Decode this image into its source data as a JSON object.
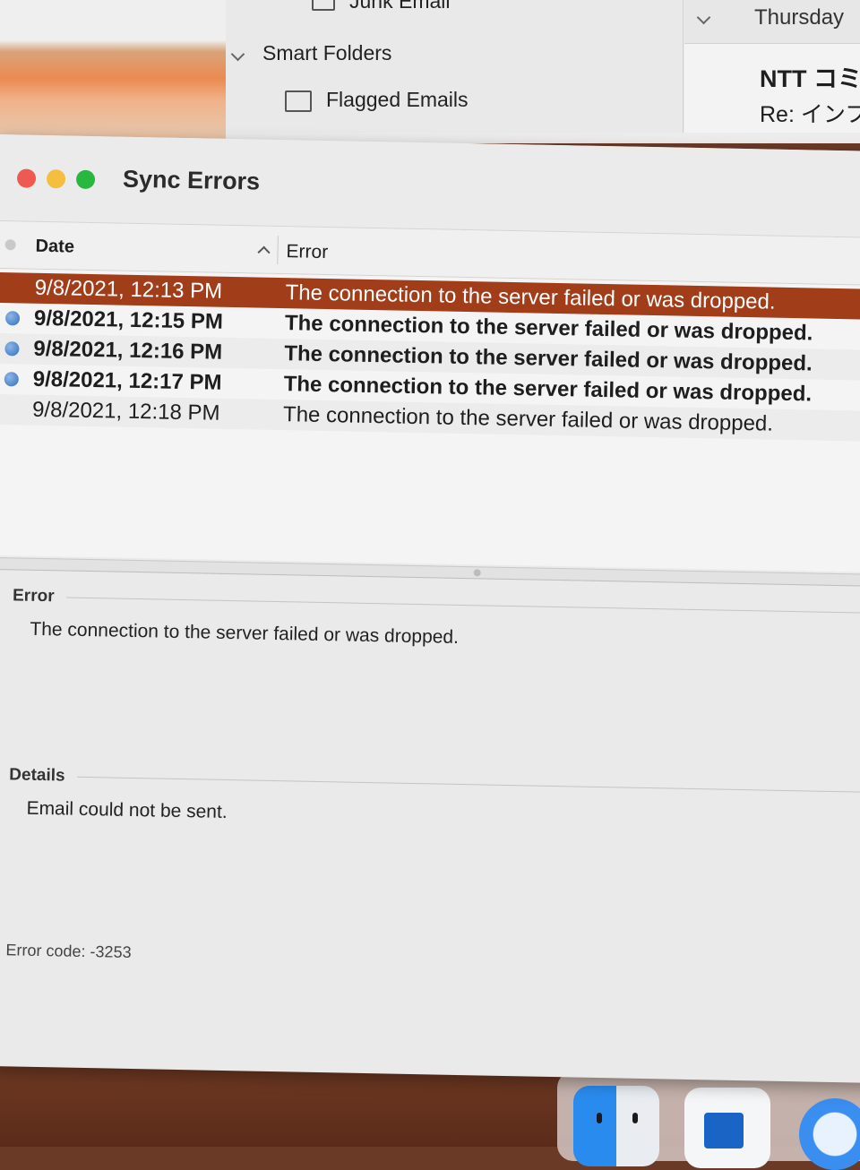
{
  "background_app": {
    "folders": {
      "junk_label": "Junk Email",
      "smart_folders_label": "Smart Folders",
      "flagged_label": "Flagged Emails"
    },
    "message_list": {
      "day_header": "Thursday",
      "sender": "NTT コミ",
      "subject": "Re: インフ"
    }
  },
  "window": {
    "title": "Sync Errors",
    "traffic_lights": {
      "close": "#ee5a52",
      "minimize": "#f4be3e",
      "zoom": "#27b840"
    }
  },
  "table": {
    "columns": {
      "date": "Date",
      "error": "Error"
    },
    "rows": [
      {
        "date": "9/8/2021, 12:13 PM",
        "error": "The connection to the server failed or was dropped.",
        "state": "selected"
      },
      {
        "date": "9/8/2021, 12:15 PM",
        "error": "The connection to the server failed or was dropped.",
        "state": "unread"
      },
      {
        "date": "9/8/2021, 12:16 PM",
        "error": "The connection to the server failed or was dropped.",
        "state": "unread"
      },
      {
        "date": "9/8/2021, 12:17 PM",
        "error": "The connection to the server failed or was dropped.",
        "state": "unread"
      },
      {
        "date": "9/8/2021, 12:18 PM",
        "error": "The connection to the server failed or was dropped.",
        "state": "read"
      }
    ]
  },
  "detail": {
    "error_label": "Error",
    "error_text": "The connection to the server failed or was dropped.",
    "details_label": "Details",
    "details_text": "Email could not be sent.",
    "error_code": "Error code: -3253"
  },
  "colors": {
    "selection": "#a23d1a",
    "unread_dot": "#2f6fc0"
  },
  "dock": {
    "apps": [
      "finder-icon",
      "outlook-icon",
      "safari-icon"
    ]
  }
}
